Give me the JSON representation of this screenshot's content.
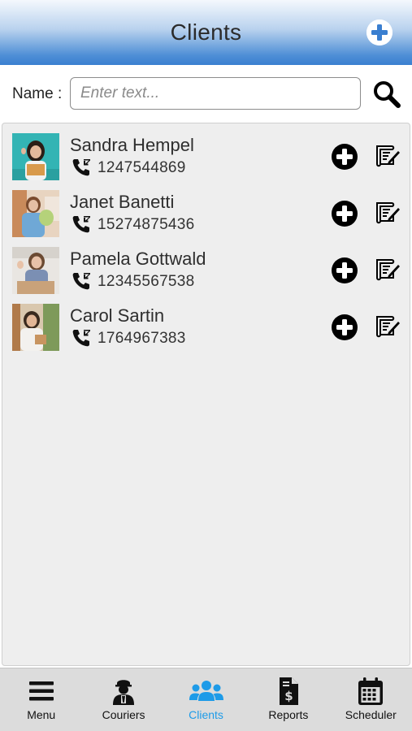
{
  "header": {
    "title": "Clients",
    "add_icon": "plus-circle-icon"
  },
  "search": {
    "label": "Name :",
    "placeholder": "Enter text...",
    "value": "",
    "search_icon": "magnifier-icon"
  },
  "clients": [
    {
      "name": "Sandra Hempel",
      "phone": "1247544869"
    },
    {
      "name": "Janet Banetti",
      "phone": "15274875436"
    },
    {
      "name": "Pamela Gottwald",
      "phone": "12345567538"
    },
    {
      "name": "Carol Sartin",
      "phone": "1764967383"
    }
  ],
  "nav": {
    "items": [
      {
        "label": "Menu",
        "icon": "hamburger-icon",
        "active": false
      },
      {
        "label": "Couriers",
        "icon": "courier-icon",
        "active": false
      },
      {
        "label": "Clients",
        "icon": "users-icon",
        "active": true
      },
      {
        "label": "Reports",
        "icon": "invoice-dollar-icon",
        "active": false
      },
      {
        "label": "Scheduler",
        "icon": "calendar-icon",
        "active": false
      }
    ]
  },
  "colors": {
    "header_gradient_bottom": "#3a7fd0",
    "active_nav": "#1e9be8",
    "list_bg": "#eeeeee",
    "nav_bg": "#dcdcdc"
  }
}
